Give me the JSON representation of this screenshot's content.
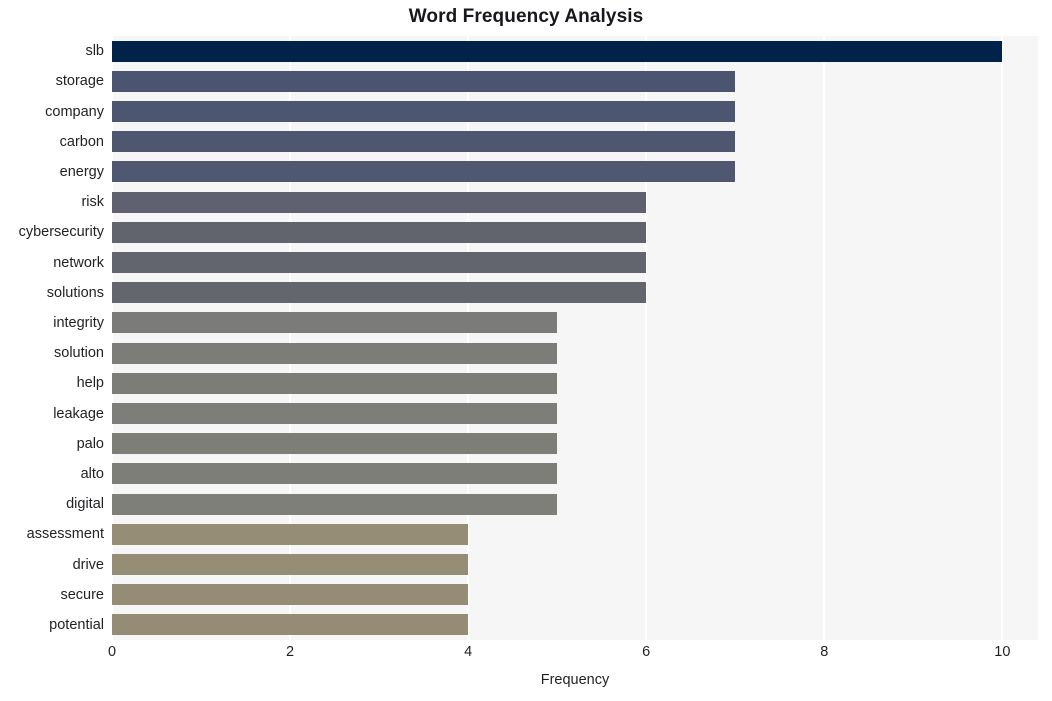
{
  "chart_data": {
    "type": "bar",
    "orientation": "horizontal",
    "title": "Word Frequency Analysis",
    "xlabel": "Frequency",
    "ylabel": "",
    "categories": [
      "slb",
      "storage",
      "company",
      "carbon",
      "energy",
      "risk",
      "cybersecurity",
      "network",
      "solutions",
      "integrity",
      "solution",
      "help",
      "leakage",
      "palo",
      "alto",
      "digital",
      "assessment",
      "drive",
      "secure",
      "potential"
    ],
    "values": [
      10,
      7,
      7,
      7,
      7,
      6,
      6,
      6,
      6,
      5,
      5,
      5,
      5,
      5,
      5,
      5,
      4,
      4,
      4,
      4
    ],
    "xlim": [
      0,
      10.4
    ],
    "xticks": [
      0,
      2,
      4,
      6,
      8,
      10
    ],
    "xtick_labels": [
      "0",
      "2",
      "4",
      "6",
      "8",
      "10"
    ],
    "grid": "vertical-white-on-light-gray",
    "legend": "none",
    "bar_colors": [
      "#012349",
      "#4c5570",
      "#4d5670",
      "#4e576f",
      "#4f5870",
      "#5f6170",
      "#62646d",
      "#63656e",
      "#64666e",
      "#7b7b79",
      "#7c7c79",
      "#7d7d78",
      "#7d7d79",
      "#7e7e79",
      "#7e7e78",
      "#7f7f79",
      "#958d76",
      "#958d75",
      "#948c75",
      "#948c74"
    ],
    "plot_background": "#f6f6f7",
    "figure_background": "#ffffff",
    "title_color": "#16181d",
    "tick_color": "#1f2124"
  }
}
